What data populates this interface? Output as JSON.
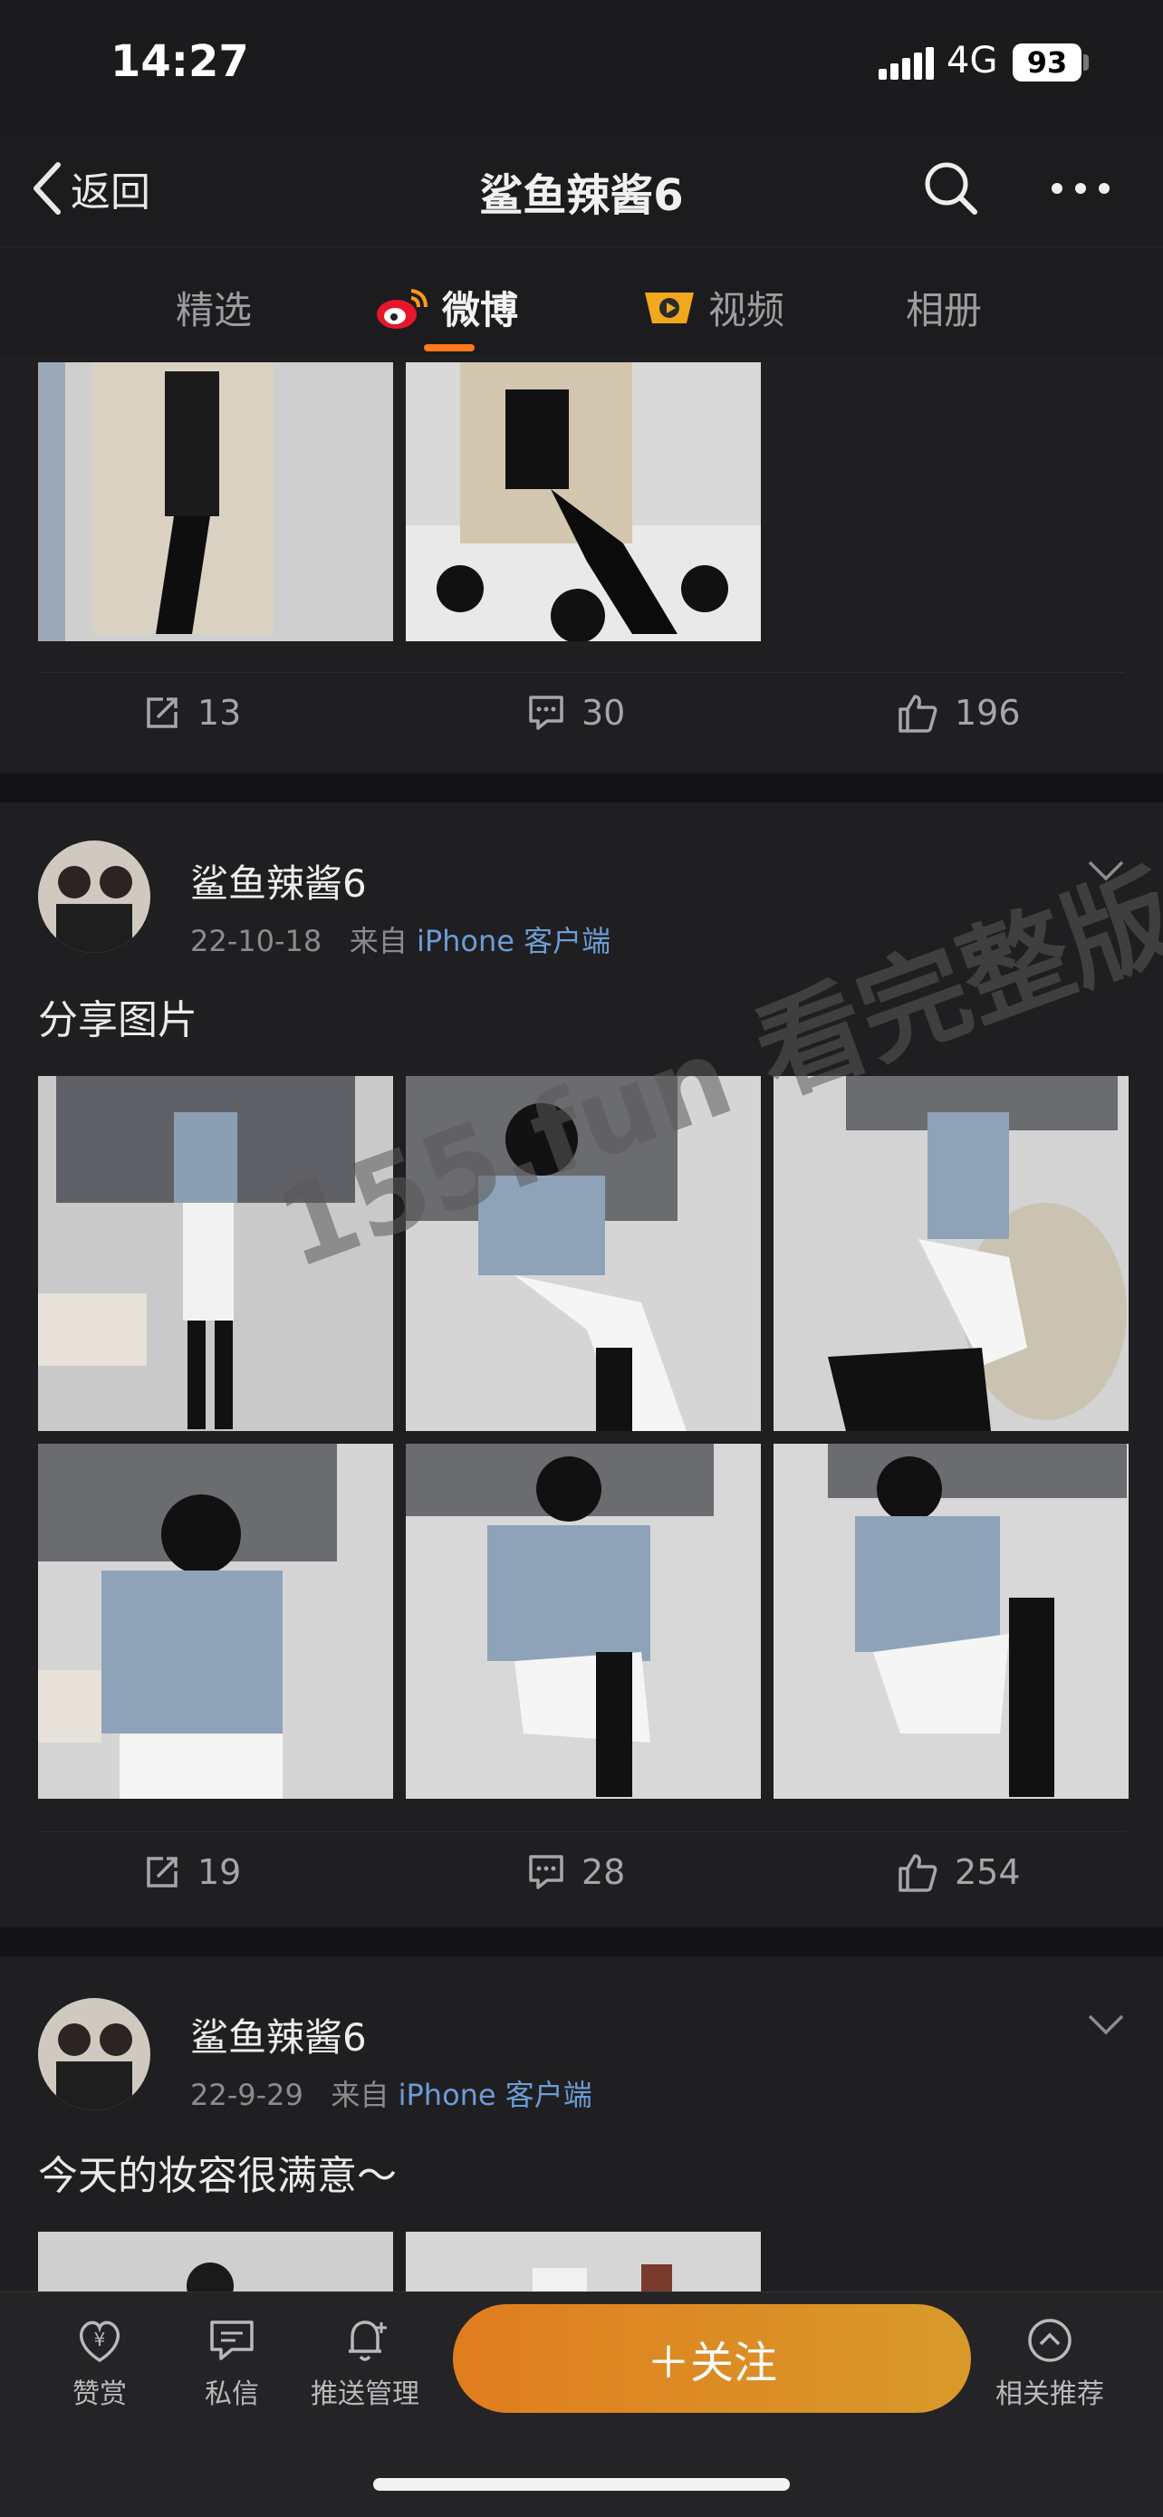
{
  "status_bar": {
    "time": "14:27",
    "network": "4G",
    "battery": "93"
  },
  "nav": {
    "back_label": "返回",
    "title": "鲨鱼辣酱6"
  },
  "tabs": [
    {
      "label": "精选",
      "active": false
    },
    {
      "label": "微博",
      "active": true
    },
    {
      "label": "视频",
      "active": false
    },
    {
      "label": "相册",
      "active": false
    }
  ],
  "posts": [
    {
      "actions": {
        "repost": "13",
        "comment": "30",
        "like": "196"
      }
    },
    {
      "user": "鲨鱼辣酱6",
      "date": "22-10-18",
      "source_prefix": "来自",
      "source": "iPhone 客户端",
      "text": "分享图片",
      "actions": {
        "repost": "19",
        "comment": "28",
        "like": "254"
      }
    },
    {
      "user": "鲨鱼辣酱6",
      "date": "22-9-29",
      "source_prefix": "来自",
      "source": "iPhone 客户端",
      "text": "今天的妆容很满意～"
    }
  ],
  "watermark": "155.fun 看完整版",
  "bottom_bar": {
    "reward": "赞赏",
    "message": "私信",
    "push": "推送管理",
    "follow": "＋关注",
    "related": "相关推荐"
  },
  "colors": {
    "accent": "#ff7a1a",
    "follow_start": "#e07d1f",
    "follow_end": "#d99a2a",
    "link": "#6d9bd6"
  }
}
